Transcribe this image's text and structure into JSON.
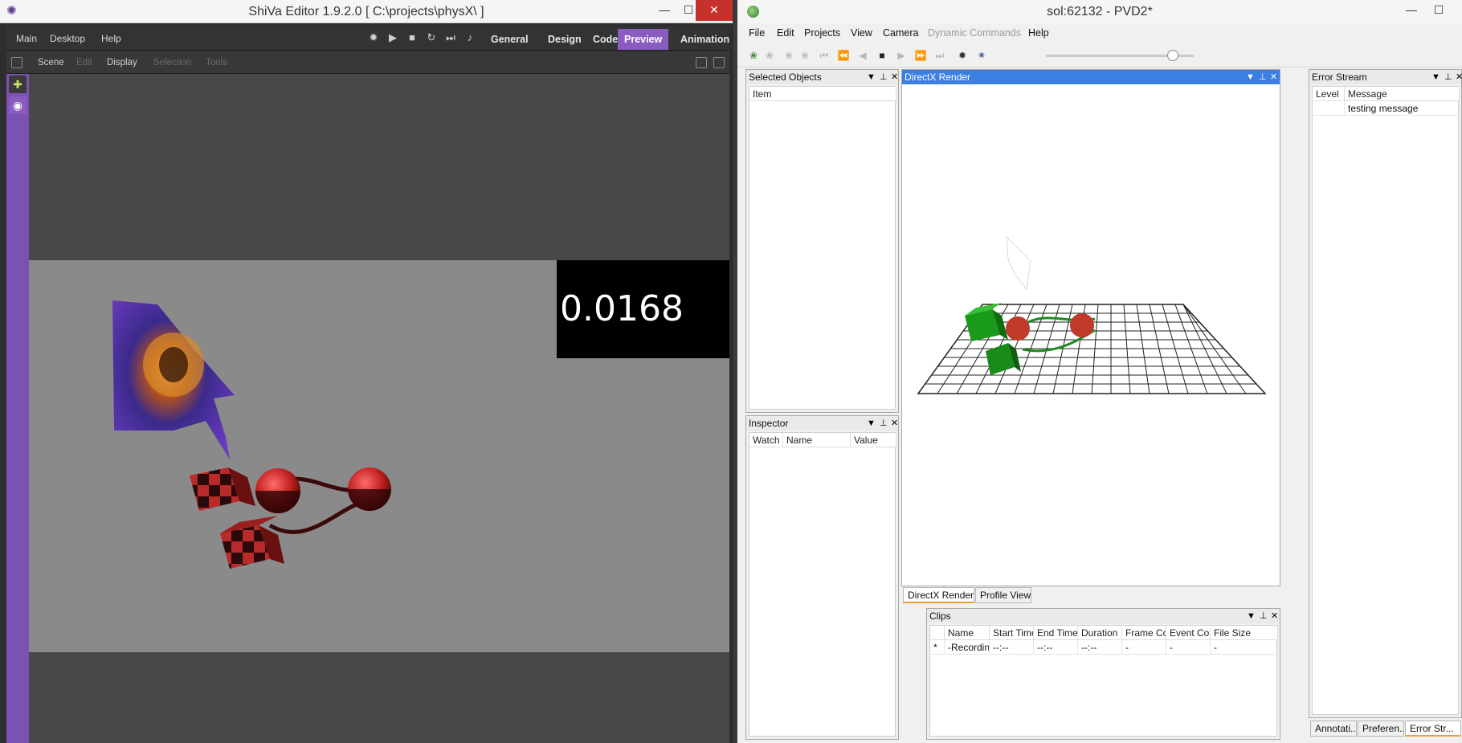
{
  "shiva": {
    "title": "ShiVa Editor 1.9.2.0 [ C:\\projects\\physX\\ ]",
    "menu": [
      "Main",
      "Desktop",
      "Help"
    ],
    "tabs": [
      "General",
      "Design",
      "Code",
      "Preview",
      "Animation"
    ],
    "active_tab": "Preview",
    "submenu": [
      "Scene",
      "Edit",
      "Display",
      "Selection",
      "Tools"
    ],
    "submenu_disabled": [
      "Edit",
      "Selection",
      "Tools"
    ],
    "readout": "0.0168",
    "accent_color": "#8a5cc0"
  },
  "pvd": {
    "title": "sol:62132 - PVD2*",
    "menu": [
      "File",
      "Edit",
      "Projects",
      "View",
      "Camera",
      "Dynamic Commands",
      "Help"
    ],
    "menu_disabled": [
      "Dynamic Commands"
    ],
    "timeline_position": 0.86,
    "selected_objects": {
      "title": "Selected Objects",
      "columns": [
        "Item"
      ]
    },
    "inspector": {
      "title": "Inspector",
      "columns": [
        "Watch",
        "Name",
        "Value"
      ]
    },
    "render": {
      "title": "DirectX Render",
      "tabs": [
        "DirectX Render",
        "Profile View"
      ]
    },
    "error_stream": {
      "title": "Error Stream",
      "columns": [
        "Level",
        "Message"
      ],
      "rows": [
        {
          "level": "",
          "message": "testing message"
        }
      ],
      "bottom_tabs": [
        "Annotati...",
        "Preferen...",
        "Error Str..."
      ]
    },
    "clips": {
      "title": "Clips",
      "columns": [
        "Name",
        "Start Time",
        "End Time",
        "Duration",
        "Frame Cou",
        "Event Cou",
        "File Size"
      ],
      "rows": [
        {
          "marker": "*",
          "name": "-Recording",
          "start": "--:--",
          "end": "--:--",
          "duration": "--:--",
          "frames": "-",
          "events": "-",
          "size": "-"
        }
      ]
    }
  }
}
